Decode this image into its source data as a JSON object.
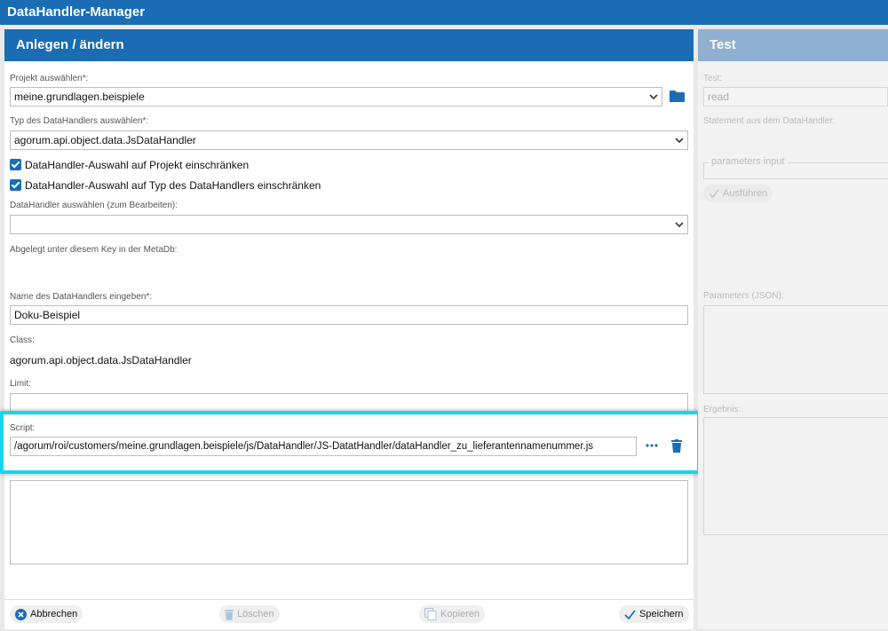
{
  "app": {
    "title": "DataHandler-Manager"
  },
  "left": {
    "title": "Anlegen / ändern",
    "project_label": "Projekt auswählen*:",
    "project_value": "meine.grundlagen.beispiele",
    "type_label": "Typ des DataHandlers auswählen*:",
    "type_value": "agorum.api.object.data.JsDataHandler",
    "restrict_project_label": "DataHandler-Auswahl auf Projekt einschränken",
    "restrict_type_label": "DataHandler-Auswahl auf Typ des DataHandlers einschränken",
    "handler_select_label": "DataHandler auswählen (zum Bearbeiten):",
    "handler_select_value": "",
    "stored_key_label": "Abgelegt unter diesem Key in der MetaDb:",
    "name_label": "Name des DataHandlers eingeben*:",
    "name_value": "Doku-Beispiel",
    "class_label": "Class:",
    "class_value": "agorum.api.object.data.JsDataHandler",
    "limit_label": "Limit:",
    "limit_value": "",
    "script_label": "Script:",
    "script_value": "/agorum/roi/customers/meine.grundlagen.beispiele/js/DataHandler/JS-DatatHandler/dataHandler_zu_lieferantennamenummer.js",
    "buttons": {
      "cancel": "Abbrechen",
      "delete": "Löschen",
      "copy": "Kopieren",
      "save": "Speichern"
    }
  },
  "right": {
    "title": "Test",
    "test_label": "Test:",
    "test_value": "read",
    "statement_label": "Statement aus dem DataHandler:",
    "parameters_input_label": "parameters input",
    "execute_label": "Ausführen",
    "params_json_label": "Parameters (JSON):",
    "result_label": "Ergebnis:"
  },
  "colors": {
    "primary": "#1a6cb5",
    "highlight": "#18d5ee",
    "test_header": "#8fb0d0"
  },
  "icons": {
    "folder": "folder-icon",
    "dots": "more-icon",
    "trash": "trash-icon"
  }
}
